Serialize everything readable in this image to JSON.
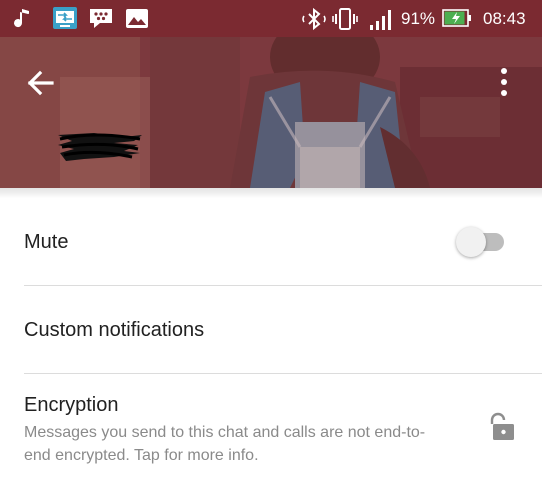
{
  "colors": {
    "status_bar": "#7b2a31",
    "battery_fill": "#4caf50",
    "primary_text": "#212121",
    "secondary_text": "#8a8a8a",
    "icon_gray": "#8e8e8e"
  },
  "status_bar": {
    "left_icons": [
      "music-note-icon",
      "screen-cast-icon",
      "bbm-chat-icon",
      "gallery-icon"
    ],
    "right_icons": [
      "bluetooth-icon",
      "vibrate-icon",
      "signal-icon",
      "battery-charging-icon"
    ],
    "battery_percent": "91%",
    "battery_level": 0.91,
    "time": "08:43"
  },
  "header": {
    "back_icon": "arrow-left-icon",
    "menu_icon": "more-vertical-icon",
    "contact_name_redacted": true
  },
  "settings": {
    "mute": {
      "label": "Mute",
      "enabled": false
    },
    "custom_notifications": {
      "label": "Custom notifications"
    },
    "encryption": {
      "label": "Encryption",
      "description": "Messages you send to this chat and calls are not end-to-end encrypted. Tap for more info.",
      "icon": "unlocked-padlock-icon"
    }
  }
}
